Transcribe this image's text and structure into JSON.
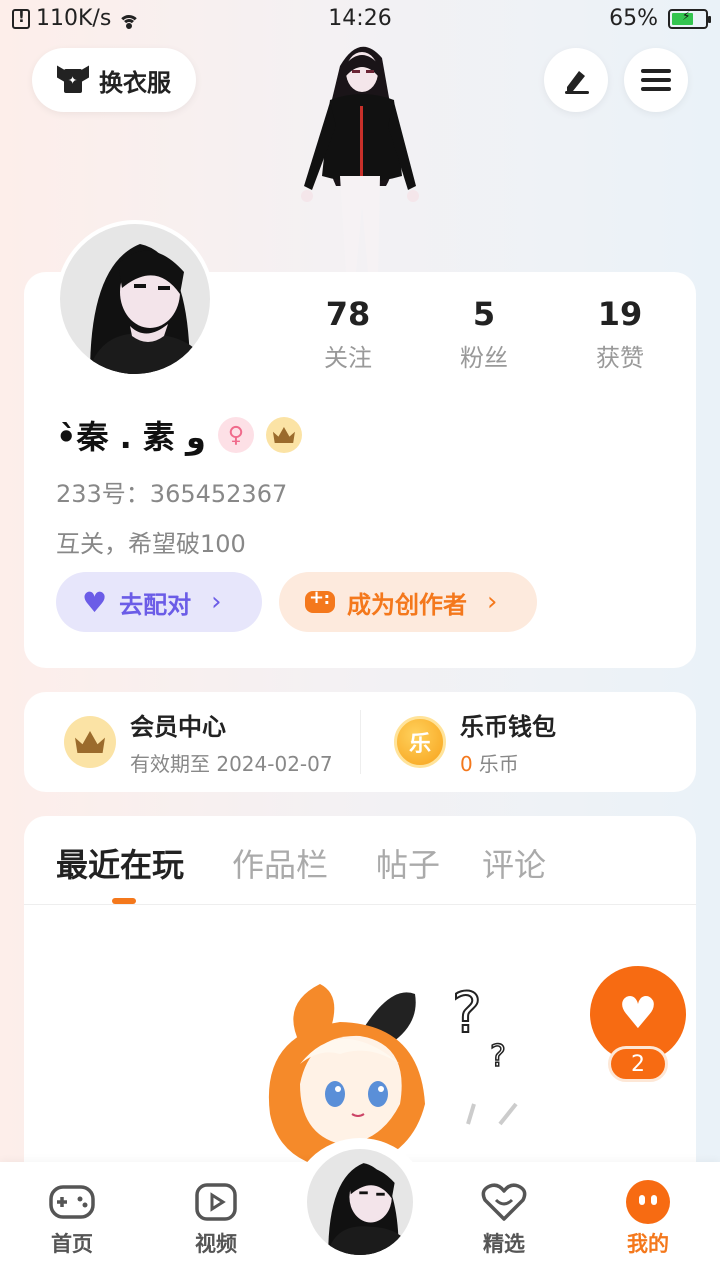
{
  "status_bar": {
    "network_speed": "110K/s",
    "time": "14:26",
    "battery": "65%",
    "battery_level": 0.65
  },
  "header": {
    "dress_up_label": "换衣服",
    "icons": [
      "shirt-icon",
      "edit-icon",
      "menu-icon"
    ]
  },
  "profile": {
    "stats": [
      {
        "value": "78",
        "label": "关注"
      },
      {
        "value": "5",
        "label": "粉丝"
      },
      {
        "value": "19",
        "label": "获赞"
      }
    ],
    "username": "•̀秦 . 素 و",
    "gender_symbol": "♀",
    "user_id": "233号：365452367",
    "bio": "互关，希望破100",
    "match_button": "去配对",
    "creator_button": "成为创作者",
    "chevron": "›"
  },
  "wallet": {
    "vip_title": "会员中心",
    "vip_expiry": "有效期至 2024-02-07",
    "coin_title": "乐币钱包",
    "coin_icon_text": "乐",
    "coin_count": "0",
    "coin_unit": "乐币"
  },
  "tabs": {
    "items": [
      "最近在玩",
      "作品栏",
      "帖子",
      "评论"
    ],
    "active": 0
  },
  "fab": {
    "like_count": "2"
  },
  "bottom_nav": {
    "items": [
      {
        "label": "首页",
        "icon": "gamepad-icon"
      },
      {
        "label": "视频",
        "icon": "play-icon"
      },
      {
        "label": "精选",
        "icon": "heart-outline-icon"
      },
      {
        "label": "我的",
        "icon": "smile-icon"
      }
    ],
    "active": 3
  },
  "colors": {
    "accent": "#f4781c",
    "match_purple": "#6b5ce7",
    "vip_gold": "#fbe3a5"
  }
}
